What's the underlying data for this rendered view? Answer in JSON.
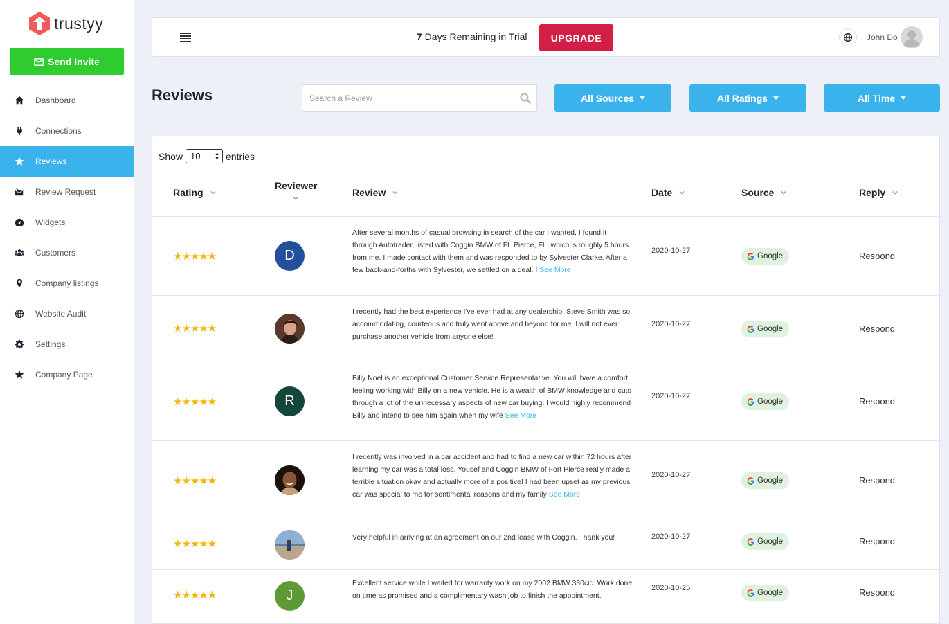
{
  "brand": {
    "name": "trustyy"
  },
  "sidebar": {
    "send_invite": "Send Invite",
    "items": [
      {
        "label": "Dashboard",
        "icon": "home-icon"
      },
      {
        "label": "Connections",
        "icon": "plug-icon"
      },
      {
        "label": "Reviews",
        "icon": "star-icon",
        "active": true
      },
      {
        "label": "Review Request",
        "icon": "mail-icon"
      },
      {
        "label": "Widgets",
        "icon": "gauge-icon"
      },
      {
        "label": "Customers",
        "icon": "users-icon"
      },
      {
        "label": "Company listings",
        "icon": "pin-icon"
      },
      {
        "label": "Website Audit",
        "icon": "globe-icon"
      },
      {
        "label": "Settings",
        "icon": "gear-icon"
      },
      {
        "label": "Company Page",
        "icon": "star-icon"
      }
    ]
  },
  "topbar": {
    "trial_bold": "7",
    "trial_text": " Days Remaining in Trial",
    "upgrade": "UPGRADE",
    "user_name": "John Do"
  },
  "page": {
    "title": "Reviews",
    "search_placeholder": "Search a Review",
    "filters": {
      "sources": "All Sources",
      "ratings": "All Ratings",
      "time": "All Time"
    }
  },
  "table": {
    "show": "Show",
    "entries_value": "10",
    "entries": "entries",
    "headers": {
      "rating": "Rating",
      "reviewer": "Reviewer",
      "review": "Review",
      "date": "Date",
      "source": "Source",
      "reply": "Reply"
    },
    "see_more": "See More",
    "rows": [
      {
        "stars": "★★★★★",
        "initial": "D",
        "avatar_color": "#22509b",
        "text": "After several months of casual browsing in search of the car I wanted, I found it through Autotrader, listed with Coggin BMW of Ft. Pierce, FL. which is roughly 5 hours from me. I made contact with them and was responded to by Sylvester Clarke. After a few back-and-forths with Sylvester, we settled on a deal. I",
        "see_more": true,
        "date": "2020-10-27",
        "source": "Google",
        "reply": "Respond"
      },
      {
        "stars": "★★★★★",
        "initial": "",
        "avatar_color": "#6b4a3a",
        "text": "I recently had the best experience I've ever had at any dealership. Steve Smith was so accommodating, courteous and truly went above and beyond for me. I will not ever purchase another vehicle from anyone else!",
        "see_more": false,
        "date": "2020-10-27",
        "source": "Google",
        "reply": "Respond"
      },
      {
        "stars": "★★★★★",
        "initial": "R",
        "avatar_color": "#15463a",
        "text": "Billy Noel is an exceptional Customer Service Representative. You will have a comfort feeling working with Billy on a new vehicle. He is a wealth of BMW knowledge and cuts through a lot of the unnecessary aspects of new car buying. I would highly recommend Billy and intend to see him again when my wife",
        "see_more": true,
        "date": "2020-10-27",
        "source": "Google",
        "reply": "Respond"
      },
      {
        "stars": "★★★★★",
        "initial": "",
        "avatar_color": "#3a2418",
        "text": "I recently was involved in a car accident and had to find a new car within 72 hours after learning my car was a total loss. Yousef and Coggin BMW of Fort Pierce really made a terrible situation okay and actually more of a positive! I had been upset as my previous car was special to me for sentimental reasons and my family",
        "see_more": true,
        "date": "2020-10-27",
        "source": "Google",
        "reply": "Respond"
      },
      {
        "stars": "★★★★★",
        "initial": "",
        "avatar_color": "#7a9cc0",
        "text": "Very helpful in arriving at an agreement on our 2nd lease with Coggin. Thank you!",
        "see_more": false,
        "date": "2020-10-27",
        "source": "Google",
        "reply": "Respond"
      },
      {
        "stars": "★★★★★",
        "initial": "J",
        "avatar_color": "#5d9a35",
        "text": "Excellent service while I waited for warranty work on my 2002 BMW 330cic. Work done on time as promised and a complimentary wash job to finish the appointment.",
        "see_more": false,
        "date": "2020-10-25",
        "source": "Google",
        "reply": "Respond"
      }
    ]
  }
}
